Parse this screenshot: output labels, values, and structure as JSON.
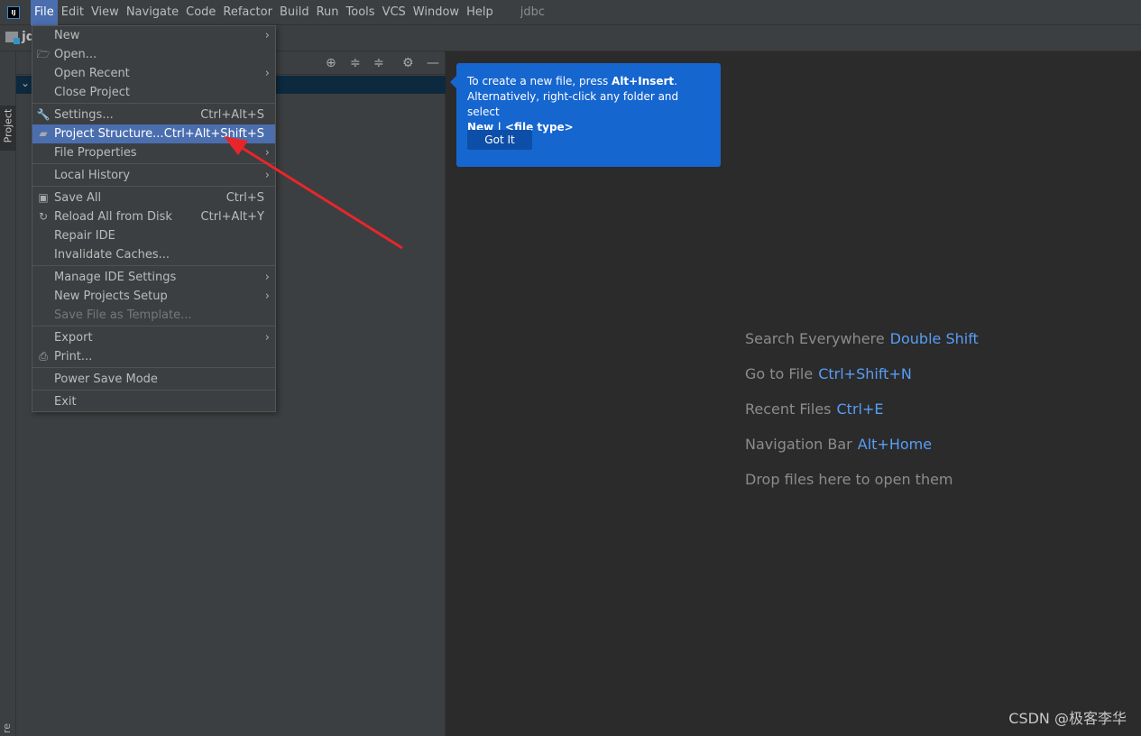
{
  "menubar": {
    "items": [
      "File",
      "Edit",
      "View",
      "Navigate",
      "Code",
      "Refactor",
      "Build",
      "Run",
      "Tools",
      "VCS",
      "Window",
      "Help"
    ],
    "active": "File",
    "project": "jdbc"
  },
  "navbar": {
    "text": "jd"
  },
  "stripe": {
    "project": "Project",
    "bottom": "re"
  },
  "file_menu": [
    {
      "label": "New",
      "arrow": true
    },
    {
      "label": "Open...",
      "icon": "folder-open-icon"
    },
    {
      "label": "Open Recent",
      "arrow": true
    },
    {
      "label": "Close Project"
    },
    {
      "sep": true
    },
    {
      "label": "Settings...",
      "shortcut": "Ctrl+Alt+S",
      "icon": "wrench-icon"
    },
    {
      "label": "Project Structure...",
      "shortcut": "Ctrl+Alt+Shift+S",
      "icon": "project-structure-icon",
      "selected": true
    },
    {
      "label": "File Properties",
      "arrow": true
    },
    {
      "sep": true
    },
    {
      "label": "Local History",
      "arrow": true
    },
    {
      "sep": true
    },
    {
      "label": "Save All",
      "shortcut": "Ctrl+S",
      "icon": "save-icon"
    },
    {
      "label": "Reload All from Disk",
      "shortcut": "Ctrl+Alt+Y",
      "icon": "reload-icon"
    },
    {
      "label": "Repair IDE"
    },
    {
      "label": "Invalidate Caches..."
    },
    {
      "sep": true
    },
    {
      "label": "Manage IDE Settings",
      "arrow": true
    },
    {
      "label": "New Projects Setup",
      "arrow": true
    },
    {
      "label": "Save File as Template...",
      "disabled": true
    },
    {
      "sep": true
    },
    {
      "label": "Export",
      "arrow": true
    },
    {
      "label": "Print...",
      "icon": "print-icon"
    },
    {
      "sep": true
    },
    {
      "label": "Power Save Mode"
    },
    {
      "sep": true
    },
    {
      "label": "Exit"
    }
  ],
  "tooltip": {
    "line1_pre": "To create a new file, press ",
    "line1_key": "Alt+Insert",
    "line1_post": ".",
    "line2": "Alternatively, right-click any folder and select",
    "line3": "New | <file type>",
    "button": "Got It"
  },
  "welcome": [
    {
      "label": "Search Everywhere",
      "key": "Double Shift"
    },
    {
      "label": "Go to File",
      "key": "Ctrl+Shift+N"
    },
    {
      "label": "Recent Files",
      "key": "Ctrl+E"
    },
    {
      "label": "Navigation Bar",
      "key": "Alt+Home"
    },
    {
      "label": "Drop files here to open them",
      "key": ""
    }
  ],
  "watermark": "CSDN @极客李华",
  "colors": {
    "accent": "#4b6eaf",
    "tooltip": "#1666d0",
    "shortcut": "#589df6",
    "annotation_arrow": "#e8262a"
  }
}
